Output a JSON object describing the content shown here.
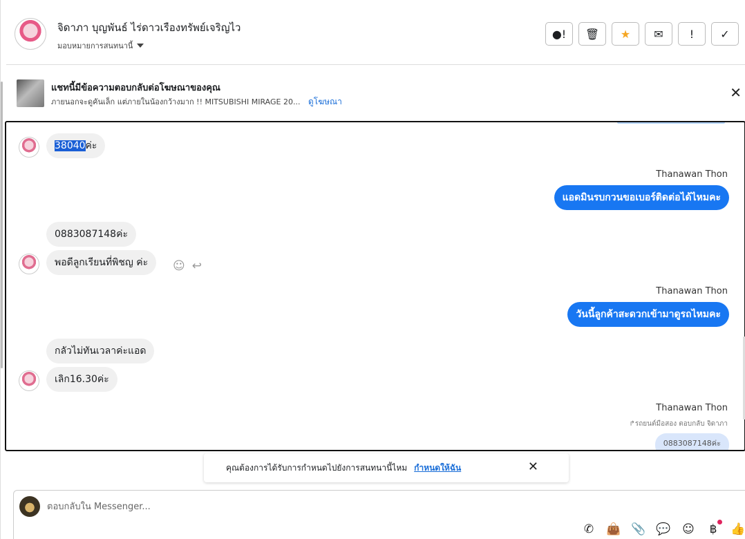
{
  "header": {
    "contact_name": "จิดาภา บุญพันธ์ ไร่ดาวเรืองทรัพย์เจริญไว",
    "assign_label": "มอบหมายการสนทนานี้",
    "actions": [
      {
        "icon": "alert-circle-icon",
        "glyph": "●!"
      },
      {
        "icon": "trash-icon",
        "glyph": "🗑"
      },
      {
        "icon": "star-icon",
        "glyph": "★"
      },
      {
        "icon": "mark-unread-icon",
        "glyph": "✉"
      },
      {
        "icon": "exclamation-icon",
        "glyph": "!"
      },
      {
        "icon": "check-icon",
        "glyph": "✓"
      }
    ]
  },
  "ad": {
    "title": "แชทนี้มีข้อความตอบกลับต่อโฆษณาของคุณ",
    "description": "ภายนอกจะดูคันเล็ก แต่ภายในน้องกว้างมาก !! MITSUBISHI MIRAGE 20...",
    "link": "ดูโฆษณา"
  },
  "messages": {
    "m1_selected": "38040",
    "m1_rest": "ค่ะ",
    "sender1": "Thanawan Thon",
    "out1": "แอดมินรบกวนขอเบอร์ติดต่อได้ไหมคะ",
    "m2": "0883087148ค่ะ",
    "m3": "พอดีลูกเรียนที่พิชญ ค่ะ",
    "sender2": "Thanawan Thon",
    "out2": "วันนี้ลูกค้าสะดวกเข้ามาดูรถไหมคะ",
    "m4": "กลัวไม่ทันเวลาค่ะแอด",
    "m5": "เลิก16.30ค่ะ",
    "sender3": "Thanawan Thon",
    "reply_note": "↱รถยนต์มือสอง ตอบกลับ จิดาภา",
    "reply_quote": "0883087148ค่ะ"
  },
  "toast": {
    "text": "คุณต้องการได้รับการกำหนดไปยังการสนทนานี้ไหม",
    "link": "กำหนดให้ฉัน"
  },
  "composer": {
    "placeholder": "ตอบกลับใน Messenger..."
  },
  "tools": [
    {
      "icon": "call-add-icon",
      "glyph": "✆"
    },
    {
      "icon": "shopping-bag-icon",
      "glyph": "👜"
    },
    {
      "icon": "paperclip-icon",
      "glyph": "📎"
    },
    {
      "icon": "saved-reply-icon",
      "glyph": "💬"
    },
    {
      "icon": "emoji-icon",
      "glyph": "☺"
    },
    {
      "icon": "baht-icon",
      "glyph": "฿"
    },
    {
      "icon": "thumbs-up-icon",
      "glyph": "👍"
    }
  ]
}
